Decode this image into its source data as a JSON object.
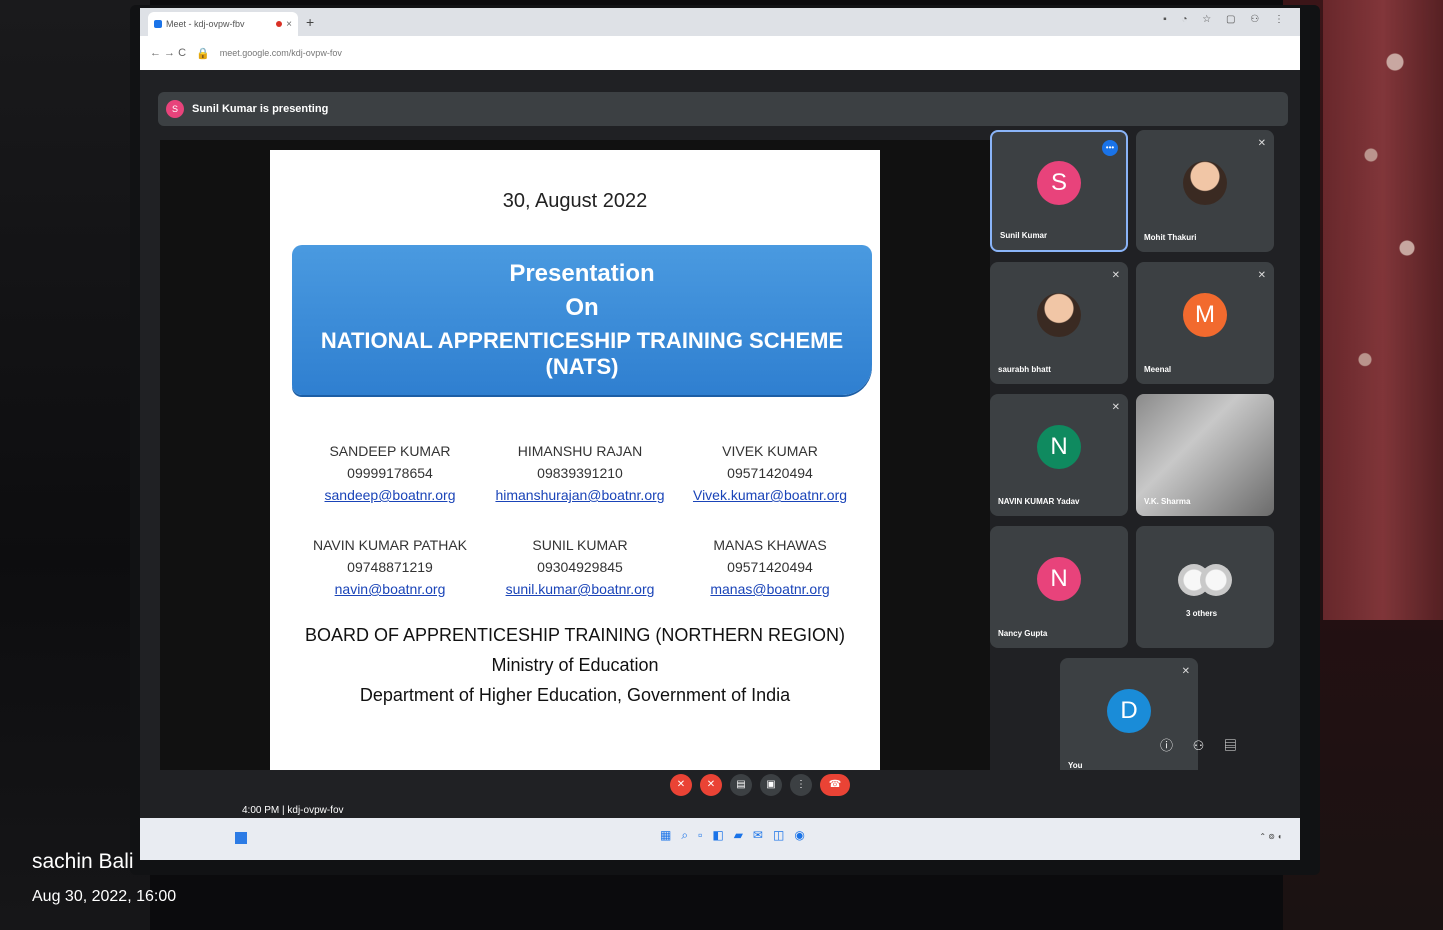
{
  "browser": {
    "tab_title": "Meet - kdj-ovpw-fbv",
    "tab_close": "×",
    "new_tab": "+",
    "url": "meet.google.com/kdj-ovpw-fov",
    "nav": "← → C"
  },
  "meet": {
    "presenting_initial": "S",
    "presenting_text": "Sunil Kumar is presenting",
    "time_code": "4:00 PM | kdj-ovpw-fov"
  },
  "slide": {
    "date": "30, August 2022",
    "title_line1": "Presentation",
    "title_line2": "On",
    "title_line3": "NATIONAL APPRENTICESHIP TRAINING SCHEME (NATS)",
    "contacts": [
      {
        "name": "SANDEEP KUMAR",
        "phone": "09999178654",
        "email": "sandeep@boatnr.org"
      },
      {
        "name": "HIMANSHU RAJAN",
        "phone": "09839391210",
        "email": "himanshurajan@boatnr.org"
      },
      {
        "name": "VIVEK KUMAR",
        "phone": "09571420494",
        "email": "Vivek.kumar@boatnr.org"
      },
      {
        "name": "NAVIN KUMAR PATHAK",
        "phone": "09748871219",
        "email": "navin@boatnr.org"
      },
      {
        "name": "SUNIL KUMAR",
        "phone": "09304929845",
        "email": "sunil.kumar@boatnr.org"
      },
      {
        "name": "MANAS KHAWAS",
        "phone": "09571420494",
        "email": "manas@boatnr.org"
      }
    ],
    "org_line1": "BOARD OF APPRENTICESHIP TRAINING (NORTHERN REGION)",
    "org_line2": "Ministry of Education",
    "org_line3": "Department of Higher Education, Government of India"
  },
  "participants": [
    {
      "name": "Sunil Kumar",
      "initial": "S",
      "color": "#e8437b",
      "type": "avatar"
    },
    {
      "name": "Mohit Thakuri",
      "type": "photo"
    },
    {
      "name": "saurabh bhatt",
      "type": "photo"
    },
    {
      "name": "Meenal",
      "initial": "M",
      "color": "#f26a2e",
      "type": "avatar"
    },
    {
      "name": "NAVIN KUMAR Yadav",
      "initial": "N",
      "color": "#0f8a5f",
      "type": "avatar"
    },
    {
      "name": "V.K. Sharma",
      "type": "video"
    },
    {
      "name": "Nancy Gupta",
      "initial": "N",
      "color": "#e8437b",
      "type": "avatar"
    },
    {
      "name": "3 others",
      "type": "others"
    },
    {
      "name": "You",
      "initial": "D",
      "color": "#1a8cd8",
      "type": "avatar"
    }
  ],
  "watermark": {
    "name": "sachin Bali",
    "datetime": "Aug 30, 2022, 16:00"
  }
}
